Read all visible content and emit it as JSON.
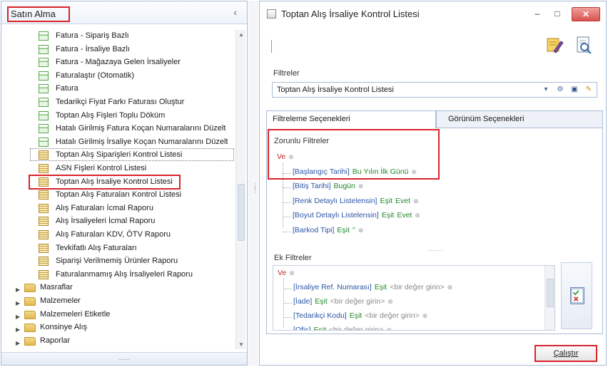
{
  "left_panel": {
    "title": "Satın Alma",
    "collapse_glyph": "‹",
    "footer_grip": "......",
    "items": [
      {
        "label": "Fatura - Sipariş Bazlı",
        "icon": "form-icon"
      },
      {
        "label": "Fatura - İrsaliye Bazlı",
        "icon": "form-icon"
      },
      {
        "label": "Fatura - Mağazaya Gelen İrsaliyeler",
        "icon": "form-icon"
      },
      {
        "label": "Faturalaştır (Otomatik)",
        "icon": "form-icon"
      },
      {
        "label": "Fatura",
        "icon": "form-icon"
      },
      {
        "label": "Tedarikçi Fiyat Farkı Faturası Oluştur",
        "icon": "form-icon"
      },
      {
        "label": "Toptan Alış Fişleri Toplu Döküm",
        "icon": "form-icon"
      },
      {
        "label": "Hatalı Girilmiş Fatura Koçan Numaralarını Düzelt",
        "icon": "form-icon"
      },
      {
        "label": "Hatalı Girilmiş İrsaliye Koçan Numaralarını Düzelt",
        "icon": "form-icon"
      },
      {
        "label": "Toptan Alış Siparişleri Kontrol Listesi",
        "icon": "report-icon"
      },
      {
        "label": "ASN Fişleri Kontrol Listesi",
        "icon": "report-icon"
      },
      {
        "label": "Toptan Alış İrsaliye Kontrol Listesi",
        "icon": "report-icon"
      },
      {
        "label": "Toptan Alış Faturaları Kontrol Listesi",
        "icon": "report-icon"
      },
      {
        "label": "Alış Faturaları İcmal Raporu",
        "icon": "report-icon"
      },
      {
        "label": "Alış İrsaliyeleri İcmal Raporu",
        "icon": "report-icon"
      },
      {
        "label": "Alış Faturaları KDV, ÖTV Raporu",
        "icon": "report-icon"
      },
      {
        "label": "Tevkifatlı Alış Faturaları",
        "icon": "report-icon"
      },
      {
        "label": "Siparişi Verilmemiş Ürünler Raporu",
        "icon": "report-icon"
      },
      {
        "label": "Faturalanmamış Alış İrsaliyeleri Raporu",
        "icon": "report-icon"
      }
    ],
    "folders": [
      {
        "label": "Masraflar"
      },
      {
        "label": "Malzemeler"
      },
      {
        "label": "Malzemeleri Etiketle"
      },
      {
        "label": "Konsinye Alış"
      },
      {
        "label": "Raporlar"
      }
    ]
  },
  "window": {
    "title": "Toptan Alış İrsaliye Kontrol Listesi",
    "min_glyph": "–",
    "max_glyph": "□",
    "close_glyph": "✕",
    "filters_label": "Filtreler",
    "filters_value": "Toptan Alış İrsaliye Kontrol Listesi",
    "tabs": [
      "Filtreleme Seçenekleri",
      "Görünüm Seçenekleri"
    ],
    "required": {
      "label": "Zorunlu Filtreler",
      "root": "Ve",
      "items": [
        {
          "field": "[Başlangıç Tarihi]",
          "op": "Bu Yılın İlk Günü",
          "value": ""
        },
        {
          "field": "[Bitiş Tarihi]",
          "op": "Bugün",
          "value": ""
        },
        {
          "field": "[Renk Detaylı Listelensin]",
          "op": "Eşit",
          "value": "Evet"
        },
        {
          "field": "[Boyut Detaylı Listelensin]",
          "op": "Eşit",
          "value": "Evet"
        },
        {
          "field": "[Barkod Tipi]",
          "op": "Eşit",
          "value": "''"
        }
      ]
    },
    "extra": {
      "label": "Ek Filtreler",
      "root": "Ve",
      "items": [
        {
          "field": "[İrsaliye Ref. Numarası]",
          "op": "Eşit",
          "value": "<bir değer girin>"
        },
        {
          "field": "[İade]",
          "op": "Eşit",
          "value": "<bir değer girin>"
        },
        {
          "field": "[Tedarikçi Kodu]",
          "op": "Eşit",
          "value": "<bir değer girin>"
        },
        {
          "field": "[Ofis]",
          "op": "Eşit",
          "value": "<bir değer girin>"
        }
      ]
    },
    "divider_dots": "......",
    "run_button": "Çalıştır"
  }
}
